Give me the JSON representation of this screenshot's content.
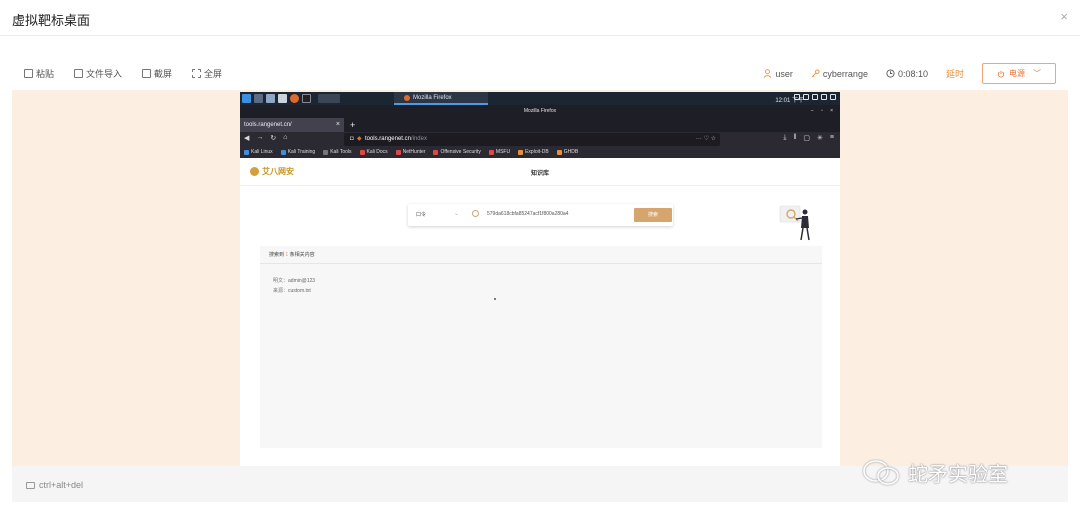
{
  "modal": {
    "title": "虚拟靶标桌面",
    "close": "×"
  },
  "toolbar": {
    "left": [
      {
        "label": "粘贴",
        "icon": "paste-icon"
      },
      {
        "label": "文件导入",
        "icon": "file-import-icon"
      },
      {
        "label": "截屏",
        "icon": "screenshot-icon"
      },
      {
        "label": "全屏",
        "icon": "fullscreen-icon"
      }
    ],
    "user": "user",
    "lab": "cyberrange",
    "timer": "0:08:10",
    "extend": "延时",
    "power": "电源"
  },
  "footer": {
    "ctrl_alt_del": "ctrl+alt+del"
  },
  "vm": {
    "panel": {
      "task": "Mozilla Firefox",
      "clock": "12:01 下午"
    },
    "firefox": {
      "window_title": "Mozilla Firefox",
      "tab": "tools.rangenet.cn/",
      "url_host": "tools.rangenet.cn",
      "url_path": "/index",
      "url_actions": "··· ♡ ☆",
      "bookmarks": [
        "Kali Linux",
        "Kali Training",
        "Kali Tools",
        "Kali Docs",
        "NetHunter",
        "Offensive Security",
        "MSFU",
        "Exploit-DB",
        "GHDB"
      ]
    },
    "page": {
      "logo": "艾八网安",
      "title": "知识库",
      "search": {
        "select": "口令",
        "value": "579da618cbfa85247acf1f800a280a4",
        "button": "搜索"
      },
      "results": {
        "heading_a": "搜索到",
        "heading_sep": "1",
        "heading_b": "条相关内容",
        "plain_label": "明文：",
        "plain_value": "admin@123",
        "source_label": "来源：",
        "source_value": "custom.txt"
      }
    }
  },
  "watermark": "蛇矛实验室",
  "colors": {
    "accent": "#e8903b",
    "desktop": "#fcefe2",
    "search_button": "#d6a56d",
    "kali_panel": "#1c2532"
  }
}
